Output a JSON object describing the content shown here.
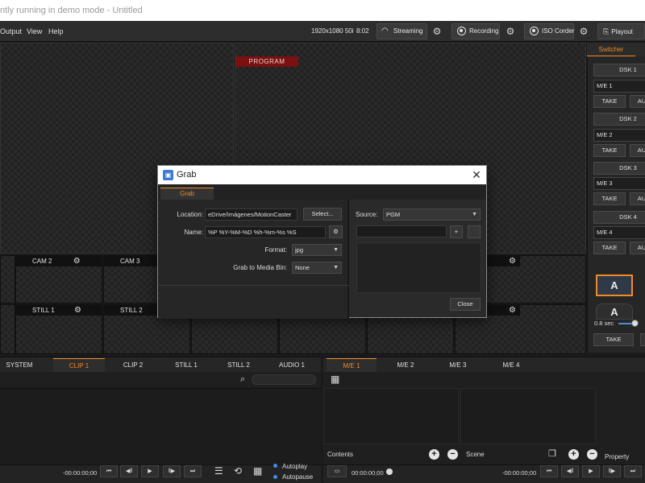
{
  "window": {
    "title": "ntly running in demo mode - Untitled"
  },
  "menu": [
    "Output",
    "View",
    "Help"
  ],
  "status": {
    "resolution": "1920x1080 50i",
    "time": "8:02"
  },
  "toolbar": {
    "streaming": "Streaming",
    "recording": "Recording",
    "iso_corder": "ISO Corder",
    "playout": "Playout"
  },
  "program_label": "PROGRAM",
  "tiles_row1": [
    "CAM 2",
    "CAM 3"
  ],
  "tiles_row2": [
    "STILL 1",
    "STILL 2"
  ],
  "switcher": {
    "tab": "Switcher",
    "dsk": [
      "DSK 1",
      "DSK 2",
      "DSK 3",
      "DSK 4"
    ],
    "me": [
      "M/E 1",
      "M/E 2",
      "M/E 3",
      "M/E 4"
    ],
    "take": "TAKE",
    "auto_cut": "AU",
    "big_a": "A",
    "duration": "0.8 sec",
    "take_bottom": "TAKE"
  },
  "bottom_left": {
    "tabs": [
      "SYSTEM",
      "CLIP 1",
      "CLIP 2",
      "STILL 1",
      "STILL 2",
      "AUDIO 1"
    ],
    "active_tab": "CLIP 1",
    "timecode": "-00:00:00;00",
    "autoplay": "Autoplay",
    "autopause": "Autopause"
  },
  "bottom_right": {
    "tabs": [
      "M/E 1",
      "M/E 2",
      "M/E 3",
      "M/E 4"
    ],
    "active_tab": "M/E 1",
    "contents": "Contents",
    "scene": "Scene",
    "property": "Property",
    "timecode_start": "00:00:00;00",
    "timecode_end": "-00:00:00;00"
  },
  "dialog": {
    "title": "Grab",
    "tab": "Grab",
    "location_label": "Location:",
    "location_value": "еDrive/Imágenes/MotionCaster",
    "select_button": "Select...",
    "name_label": "Name:",
    "name_value": "%P %Y-%M-%D %h-%m-%s %S",
    "format_label": "Format:",
    "format_value": "jpg",
    "media_bin_label": "Grab to Media Bin:",
    "media_bin_value": "None",
    "source_label": "Source:",
    "source_value": "PGM",
    "plus": "+",
    "close_button": "Close"
  },
  "colors": {
    "accent": "#f08a28",
    "program_red": "#7a1010",
    "active_blue": "#3b7bd6"
  }
}
